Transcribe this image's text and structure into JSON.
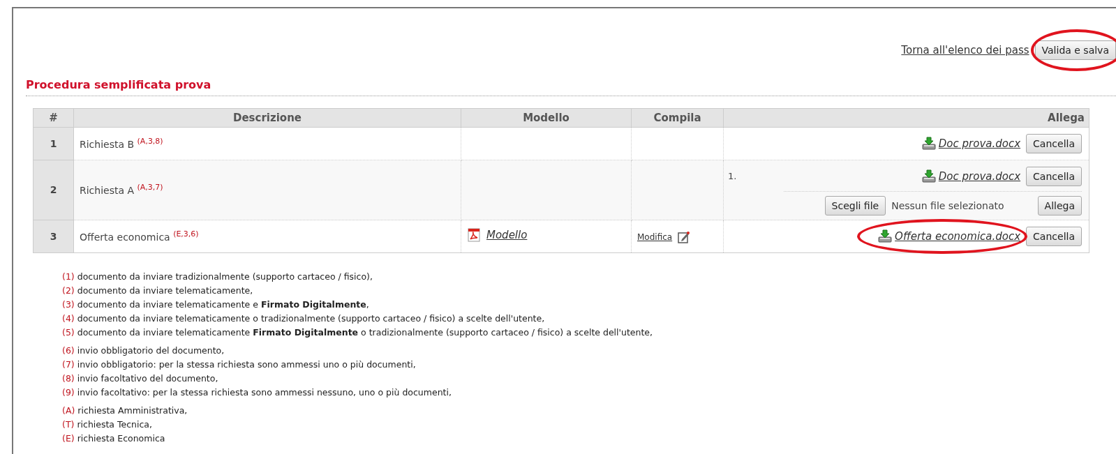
{
  "header": {
    "back_link": "Torna all'elenco dei pass",
    "primary_button": {
      "label": "Valida e salva",
      "circled": true
    }
  },
  "section_title": "Procedura semplificata prova",
  "table": {
    "columns": [
      "#",
      "Descrizione",
      "Modello",
      "Compila",
      "Allega"
    ],
    "rows": [
      {
        "number": "1",
        "description": "Richiesta B",
        "refs": "(A,3,8)",
        "attachments": [
          {
            "file": "Doc prova.docx",
            "button": "Cancella",
            "circled": false
          }
        ]
      },
      {
        "number": "2",
        "description": "Richiesta A",
        "refs": "(A,3,7)",
        "attachments": [
          {
            "index": "1.",
            "file": "Doc prova.docx",
            "button": "Cancella",
            "circled": false
          }
        ],
        "upload": {
          "choose_button": "Scegli file",
          "status": "Nessun file selezionato",
          "submit_button": "Allega"
        }
      },
      {
        "number": "3",
        "description": "Offerta economica",
        "refs": "(E,3,6)",
        "model": {
          "label": "Modello"
        },
        "fill": {
          "label": "Modifica"
        },
        "attachments": [
          {
            "file": "Offerta economica.docx",
            "button": "Cancella",
            "circled": true
          }
        ]
      }
    ]
  },
  "legend": [
    [
      {
        "marker": "(1)",
        "text": "documento da inviare tradizionalmente (supporto cartaceo / fisico),"
      },
      {
        "marker": "(2)",
        "text": "documento da inviare telematicamente,"
      },
      {
        "marker": "(3)",
        "text": "documento da inviare telematicamente e **Firmato Digitalmente**,"
      },
      {
        "marker": "(4)",
        "text": "documento da inviare telematicamente o tradizionalmente (supporto cartaceo / fisico) a scelte dell'utente,"
      },
      {
        "marker": "(5)",
        "text": "documento da inviare telematicamente **Firmato Digitalmente** o tradizionalmente (supporto cartaceo / fisico) a scelte dell'utente,"
      }
    ],
    [
      {
        "marker": "(6)",
        "text": "invio obbligatorio del documento,"
      },
      {
        "marker": "(7)",
        "text": "invio obbligatorio: per la stessa richiesta sono ammessi uno o più documenti,"
      },
      {
        "marker": "(8)",
        "text": "invio facoltativo del documento,"
      },
      {
        "marker": "(9)",
        "text": "invio facoltativo: per la stessa richiesta sono ammessi nessuno, uno o più documenti,"
      }
    ],
    [
      {
        "marker": "(A)",
        "text": "richiesta Amministrativa,"
      },
      {
        "marker": "(T)",
        "text": "richiesta Tecnica,"
      },
      {
        "marker": "(E)",
        "text": "richiesta Economica"
      }
    ]
  ]
}
